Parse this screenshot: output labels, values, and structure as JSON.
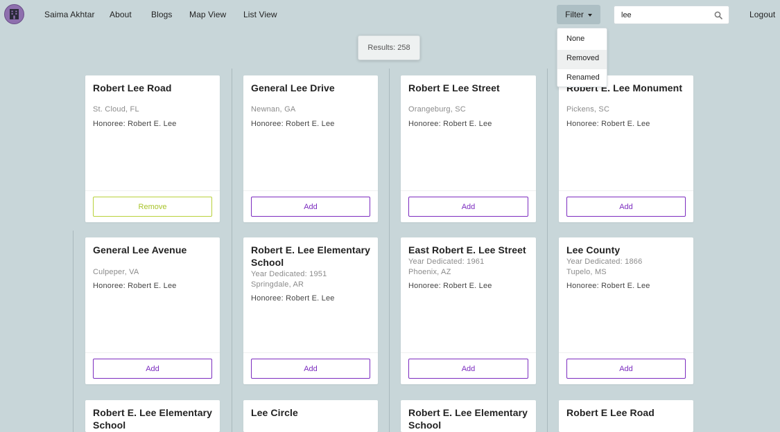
{
  "nav": {
    "user": "Saima Akhtar",
    "about": "About",
    "blogs": "Blogs",
    "map_view": "Map View",
    "list_view": "List View",
    "filter_label": "Filter",
    "logout": "Logout"
  },
  "search": {
    "value": "lee"
  },
  "filter_options": [
    "None",
    "Removed",
    "Renamed"
  ],
  "filter_highlighted": "Removed",
  "results_text": "Results: 258",
  "colors": {
    "background": "#c8d6d9",
    "accent": "#7b2bbf",
    "remove": "#a8c42a",
    "logo": "#8e6fae"
  },
  "cards": [
    {
      "title": "Robert Lee Road",
      "year": "",
      "location": "St. Cloud, FL",
      "honoree": "Honoree: Robert E. Lee",
      "action": "Remove"
    },
    {
      "title": "General Lee Drive",
      "year": "",
      "location": "Newnan, GA",
      "honoree": "Honoree: Robert E. Lee",
      "action": "Add"
    },
    {
      "title": "Robert E Lee Street",
      "year": "",
      "location": "Orangeburg, SC",
      "honoree": "Honoree: Robert E. Lee",
      "action": "Add"
    },
    {
      "title": "Robert E. Lee Monument",
      "year": "",
      "location": "Pickens, SC",
      "honoree": "Honoree: Robert E. Lee",
      "action": "Add"
    },
    {
      "title": "General Lee Avenue",
      "year": "",
      "location": "Culpeper, VA",
      "honoree": "Honoree: Robert E. Lee",
      "action": "Add"
    },
    {
      "title": "Robert E. Lee Elementary School",
      "year": "Year Dedicated: 1951",
      "location": "Springdale, AR",
      "honoree": "Honoree: Robert E. Lee",
      "action": "Add"
    },
    {
      "title": "East Robert E. Lee Street",
      "year": "Year Dedicated: 1961",
      "location": "Phoenix, AZ",
      "honoree": "Honoree: Robert E. Lee",
      "action": "Add"
    },
    {
      "title": "Lee County",
      "year": "Year Dedicated: 1866",
      "location": "Tupelo, MS",
      "honoree": "Honoree: Robert E. Lee",
      "action": "Add"
    },
    {
      "title": "Robert E. Lee Elementary School",
      "year": "",
      "location": "",
      "honoree": "",
      "action": ""
    },
    {
      "title": "Lee Circle",
      "year": "",
      "location": "",
      "honoree": "",
      "action": ""
    },
    {
      "title": "Robert E. Lee Elementary School",
      "year": "",
      "location": "",
      "honoree": "",
      "action": ""
    },
    {
      "title": "Robert E Lee Road",
      "year": "",
      "location": "",
      "honoree": "",
      "action": ""
    }
  ]
}
